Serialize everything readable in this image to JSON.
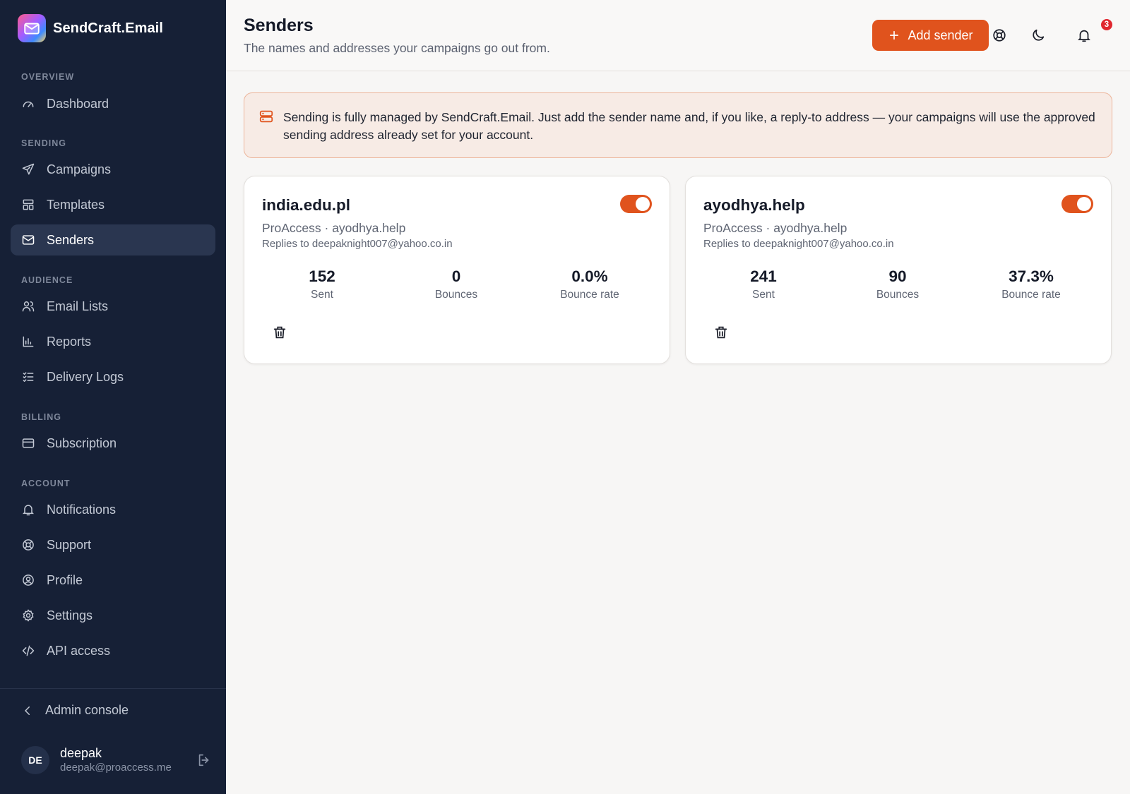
{
  "brand": {
    "name": "SendCraft.Email"
  },
  "sidebar": {
    "sections": [
      {
        "label": "OVERVIEW"
      },
      {
        "label": "SENDING"
      },
      {
        "label": "AUDIENCE"
      },
      {
        "label": "BILLING"
      },
      {
        "label": "ACCOUNT"
      }
    ],
    "items": [
      {
        "label": "Dashboard",
        "icon": "gauge-icon"
      },
      {
        "label": "Campaigns",
        "icon": "paper-plane-icon"
      },
      {
        "label": "Templates",
        "icon": "layout-icon"
      },
      {
        "label": "Senders",
        "icon": "mail-icon",
        "active": true
      },
      {
        "label": "Email Lists",
        "icon": "users-icon"
      },
      {
        "label": "Reports",
        "icon": "bar-chart-icon"
      },
      {
        "label": "Delivery Logs",
        "icon": "checklist-icon"
      },
      {
        "label": "Subscription",
        "icon": "credit-card-icon"
      },
      {
        "label": "Notifications",
        "icon": "bell-icon"
      },
      {
        "label": "Support",
        "icon": "lifebuoy-icon"
      },
      {
        "label": "Profile",
        "icon": "user-circle-icon"
      },
      {
        "label": "Settings",
        "icon": "gear-icon"
      },
      {
        "label": "API access",
        "icon": "code-icon"
      }
    ],
    "admin_console": "Admin console",
    "user": {
      "initials": "DE",
      "name": "deepak",
      "email": "deepak@proaccess.me"
    }
  },
  "header": {
    "title": "Senders",
    "subtitle": "The names and addresses your campaigns go out from.",
    "add_button": "Add sender",
    "notification_count": "3"
  },
  "banner": {
    "text": "Sending is fully managed by SendCraft.Email. Just add the sender name and, if you like, a reply-to address — your campaigns will use the approved sending address already set for your account."
  },
  "senders": [
    {
      "name": "india.edu.pl",
      "subline": "ProAccess · ayodhya.help",
      "reply_to": "Replies to deepaknight007@yahoo.co.in",
      "enabled": true,
      "stats": [
        {
          "value": "152",
          "label": "Sent"
        },
        {
          "value": "0",
          "label": "Bounces"
        },
        {
          "value": "0.0%",
          "label": "Bounce rate"
        }
      ]
    },
    {
      "name": "ayodhya.help",
      "subline": "ProAccess · ayodhya.help",
      "reply_to": "Replies to deepaknight007@yahoo.co.in",
      "enabled": true,
      "stats": [
        {
          "value": "241",
          "label": "Sent"
        },
        {
          "value": "90",
          "label": "Bounces"
        },
        {
          "value": "37.3%",
          "label": "Bounce rate"
        }
      ]
    }
  ],
  "colors": {
    "accent": "#e0531d",
    "sidebar_bg": "#162036",
    "badge": "#e0272f"
  }
}
